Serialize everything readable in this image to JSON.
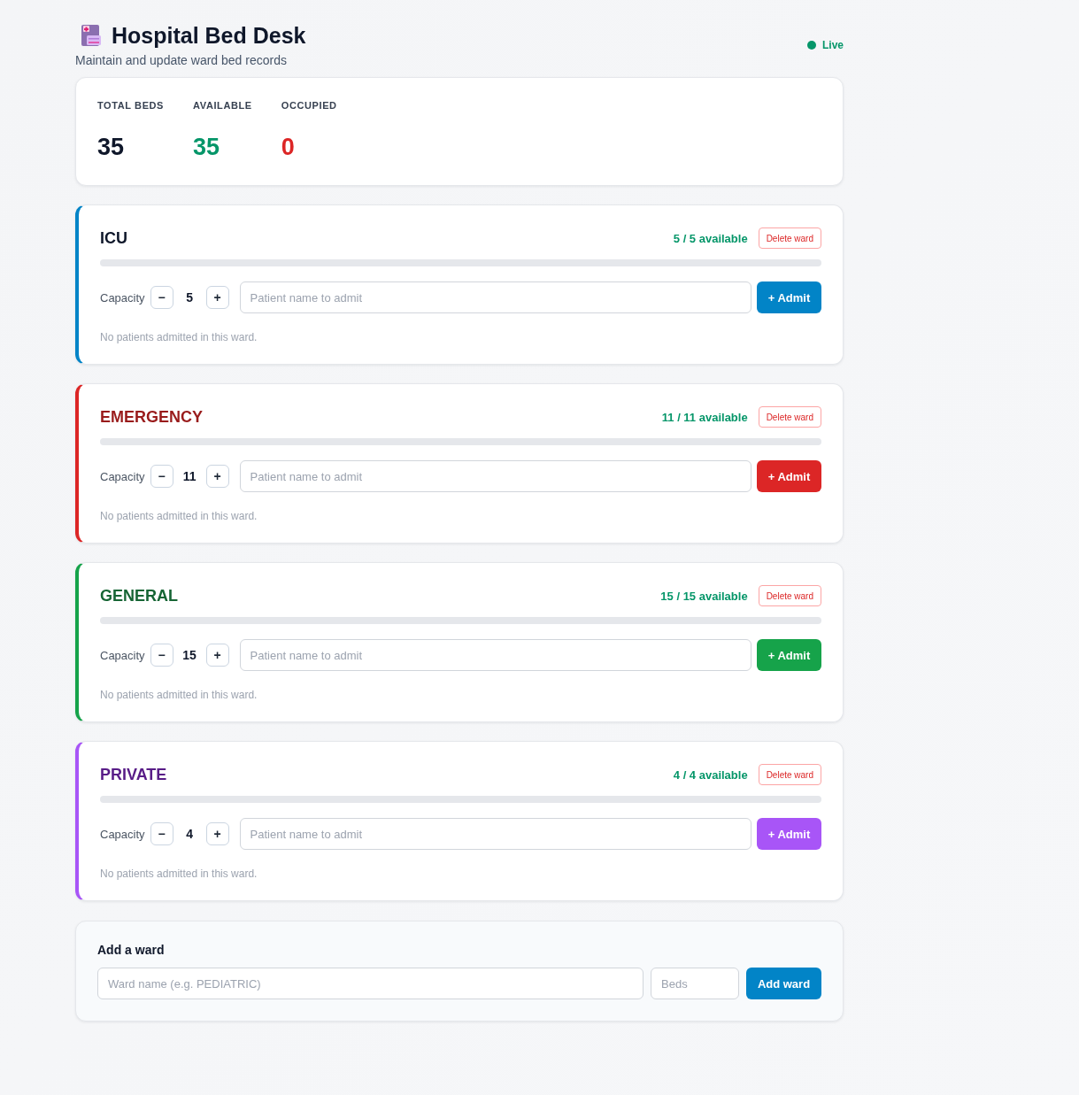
{
  "header": {
    "title": "Hospital Bed Desk",
    "subtitle": "Maintain and update ward bed records",
    "status": "Live"
  },
  "stats": [
    {
      "label": "TOTAL BEDS",
      "value": "35",
      "color": "#0f172a"
    },
    {
      "label": "AVAILABLE",
      "value": "35",
      "color": "#059669"
    },
    {
      "label": "OCCUPIED",
      "value": "0",
      "color": "#dc2626"
    }
  ],
  "wards": [
    {
      "title": {
        "text": "ICU",
        "color": "#0f172a"
      },
      "color": "#0284c7",
      "availability": "5 / 5 available",
      "delete_label": "Delete ward",
      "level": 0,
      "capacity_label": "Capacity",
      "decrement": "−",
      "capacity": "5",
      "increment": "+",
      "patient_input": {
        "placeholder": "Patient name to admit"
      },
      "admit_label": "+ Admit",
      "empty_note": "No patients admitted in this ward."
    },
    {
      "title": {
        "text": "EMERGENCY",
        "color": "#991b1b"
      },
      "color": "#dc2626",
      "availability": "11 / 11 available",
      "delete_label": "Delete ward",
      "level": 0,
      "capacity_label": "Capacity",
      "decrement": "−",
      "capacity": "11",
      "increment": "+",
      "patient_input": {
        "placeholder": "Patient name to admit"
      },
      "admit_label": "+ Admit",
      "empty_note": "No patients admitted in this ward."
    },
    {
      "title": {
        "text": "GENERAL",
        "color": "#166534"
      },
      "color": "#16a34a",
      "availability": "15 / 15 available",
      "delete_label": "Delete ward",
      "level": 0,
      "capacity_label": "Capacity",
      "decrement": "−",
      "capacity": "15",
      "increment": "+",
      "patient_input": {
        "placeholder": "Patient name to admit"
      },
      "admit_label": "+ Admit",
      "empty_note": "No patients admitted in this ward."
    },
    {
      "title": {
        "text": "PRIVATE",
        "color": "#581c87"
      },
      "color": "#a855f7",
      "availability": "4 / 4 available",
      "delete_label": "Delete ward",
      "level": 0,
      "capacity_label": "Capacity",
      "decrement": "−",
      "capacity": "4",
      "increment": "+",
      "patient_input": {
        "placeholder": "Patient name to admit"
      },
      "admit_label": "+ Admit",
      "empty_note": "No patients admitted in this ward."
    }
  ],
  "add_ward": {
    "title": "Add a ward",
    "name_input": {
      "placeholder": "Ward name (e.g. PEDIATRIC)"
    },
    "beds_input": {
      "placeholder": "Beds"
    },
    "button": "Add ward"
  }
}
